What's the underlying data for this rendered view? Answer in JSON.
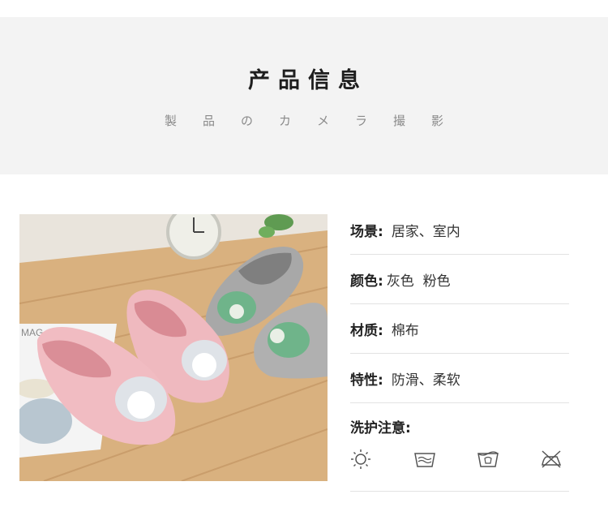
{
  "banner": {
    "title": "产品信息",
    "subtitle": "製品のカメラ撮影"
  },
  "photo": {
    "description_icon": "product-photo",
    "colors": {
      "wood": "#d6ad7c",
      "pink": "#eeb7bd",
      "gray": "#a9a9a9",
      "green": "#6fb48a"
    }
  },
  "specs": [
    {
      "label": "场景:",
      "value": "居家、室内"
    },
    {
      "label": "颜色:",
      "value": "灰色  粉色"
    },
    {
      "label": "材质:",
      "value": "棉布"
    },
    {
      "label": "特性:",
      "value": "防滑、柔软"
    }
  ],
  "care": {
    "title": "洗护注意:",
    "icons": [
      "sun-dry-icon",
      "hand-wash-icon",
      "machine-wash-icon",
      "no-iron-icon"
    ]
  }
}
